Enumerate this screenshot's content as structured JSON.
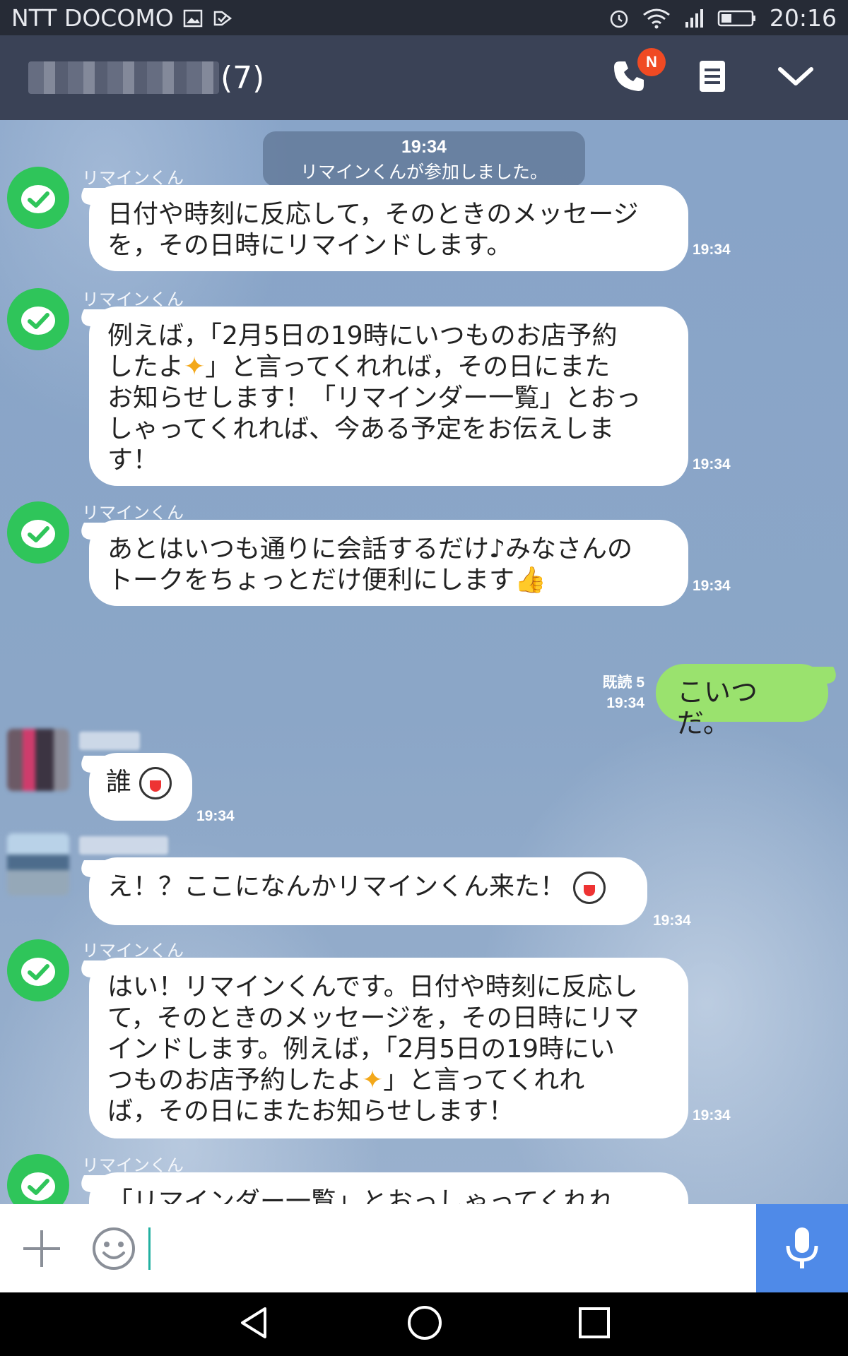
{
  "status_bar": {
    "carrier": "NTT DOCOMO",
    "time": "20:16",
    "icons": [
      "gallery-icon",
      "check-icon",
      "alarm-icon",
      "wifi-icon",
      "signal-icon",
      "battery-icon"
    ]
  },
  "header": {
    "count": "(7)",
    "call_badge": "N",
    "icons": [
      "phone-icon",
      "notes-icon",
      "chevron-down-icon"
    ]
  },
  "system_message": {
    "time": "19:34",
    "text": "リマインくんが参加しました。"
  },
  "messages": [
    {
      "sender": "リマインくん",
      "lines": [
        "日付や時刻に反応して，そのときのメッセージ",
        "を，その日時にリマインドします。"
      ],
      "time": "19:34"
    },
    {
      "sender": "リマインくん",
      "lines": [
        "例えば，「2月5日の19時にいつものお店予約",
        "したよ",
        "」と言ってくれれば，その日にまた",
        "お知らせします！「リマインダー一覧」とおっ",
        "しゃってくれれば、今ある予定をお伝えしま",
        "す！"
      ],
      "time": "19:34"
    },
    {
      "sender": "リマインくん",
      "lines": [
        "あとはいつも通りに会話するだけ♪みなさんの",
        "トークをちょっとだけ便利にします"
      ],
      "time": "19:34"
    },
    {
      "text": "こいつだ。",
      "read": "既読 5",
      "time": "19:34"
    },
    {
      "text": "誰",
      "time": "19:34"
    },
    {
      "text": "え！？ここになんかリマインくん来た！",
      "time": "19:34"
    },
    {
      "sender": "リマインくん",
      "lines": [
        "はい！リマインくんです。日付や時刻に反応し",
        "て，そのときのメッセージを，その日時にリマ",
        "インドします。例えば，「2月5日の19時にい",
        "つものお店予約したよ",
        "」と言ってくれれ",
        "ば，その日にまたお知らせします！"
      ],
      "time": "19:34"
    },
    {
      "sender": "リマインくん",
      "lines": [
        "「リマインダー一覧」とおっしゃってくれれ"
      ]
    }
  ],
  "input_bar": {
    "icons": [
      "plus-icon",
      "smiley-icon",
      "microphone-icon"
    ]
  },
  "nav_bar": {
    "icons": [
      "back-icon",
      "home-icon",
      "recents-icon"
    ]
  },
  "colors": {
    "header_bg": "#3a4256",
    "chat_bg": "#8aa6c9",
    "my_bubble": "#9ae26e",
    "bot_avatar": "#2fc55a",
    "badge": "#f04a23",
    "mic_button": "#4f8ae8"
  }
}
